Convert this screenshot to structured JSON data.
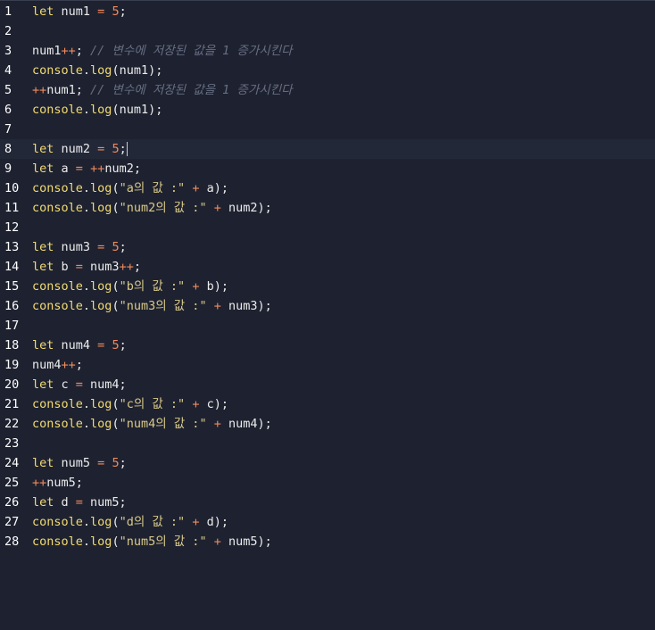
{
  "editor": {
    "active_line": 8,
    "lines": [
      {
        "number": "1",
        "tokens": [
          {
            "t": "let",
            "c": "kw"
          },
          {
            "t": " num1 ",
            "c": "id"
          },
          {
            "t": "=",
            "c": "op"
          },
          {
            "t": " ",
            "c": "id"
          },
          {
            "t": "5",
            "c": "num"
          },
          {
            "t": ";",
            "c": "punc"
          }
        ]
      },
      {
        "number": "2",
        "tokens": []
      },
      {
        "number": "3",
        "tokens": [
          {
            "t": "num1",
            "c": "id"
          },
          {
            "t": "++",
            "c": "op"
          },
          {
            "t": "; ",
            "c": "punc"
          },
          {
            "t": "// 변수에 저장된 값을 1 증가시킨다",
            "c": "cmt"
          }
        ]
      },
      {
        "number": "4",
        "tokens": [
          {
            "t": "console",
            "c": "fn"
          },
          {
            "t": ".",
            "c": "punc"
          },
          {
            "t": "log",
            "c": "fn"
          },
          {
            "t": "(num1);",
            "c": "punc"
          }
        ]
      },
      {
        "number": "5",
        "tokens": [
          {
            "t": "++",
            "c": "op"
          },
          {
            "t": "num1",
            "c": "id"
          },
          {
            "t": "; ",
            "c": "punc"
          },
          {
            "t": "// 변수에 저장된 값을 1 증가시킨다",
            "c": "cmt"
          }
        ]
      },
      {
        "number": "6",
        "tokens": [
          {
            "t": "console",
            "c": "fn"
          },
          {
            "t": ".",
            "c": "punc"
          },
          {
            "t": "log",
            "c": "fn"
          },
          {
            "t": "(num1);",
            "c": "punc"
          }
        ]
      },
      {
        "number": "7",
        "tokens": []
      },
      {
        "number": "8",
        "tokens": [
          {
            "t": "let",
            "c": "kw"
          },
          {
            "t": " num2 ",
            "c": "id"
          },
          {
            "t": "=",
            "c": "op"
          },
          {
            "t": " ",
            "c": "id"
          },
          {
            "t": "5",
            "c": "num"
          },
          {
            "t": ";",
            "c": "punc"
          }
        ],
        "cursor": true
      },
      {
        "number": "9",
        "tokens": [
          {
            "t": "let",
            "c": "kw"
          },
          {
            "t": " a ",
            "c": "id"
          },
          {
            "t": "=",
            "c": "op"
          },
          {
            "t": " ",
            "c": "id"
          },
          {
            "t": "++",
            "c": "op"
          },
          {
            "t": "num2;",
            "c": "id"
          }
        ]
      },
      {
        "number": "10",
        "tokens": [
          {
            "t": "console",
            "c": "fn"
          },
          {
            "t": ".",
            "c": "punc"
          },
          {
            "t": "log",
            "c": "fn"
          },
          {
            "t": "(",
            "c": "punc"
          },
          {
            "t": "\"a의 값 :\"",
            "c": "str"
          },
          {
            "t": " ",
            "c": "id"
          },
          {
            "t": "+",
            "c": "op"
          },
          {
            "t": " a);",
            "c": "punc"
          }
        ]
      },
      {
        "number": "11",
        "tokens": [
          {
            "t": "console",
            "c": "fn"
          },
          {
            "t": ".",
            "c": "punc"
          },
          {
            "t": "log",
            "c": "fn"
          },
          {
            "t": "(",
            "c": "punc"
          },
          {
            "t": "\"num2의 값 :\"",
            "c": "str"
          },
          {
            "t": " ",
            "c": "id"
          },
          {
            "t": "+",
            "c": "op"
          },
          {
            "t": " num2);",
            "c": "punc"
          }
        ]
      },
      {
        "number": "12",
        "tokens": []
      },
      {
        "number": "13",
        "tokens": [
          {
            "t": "let",
            "c": "kw"
          },
          {
            "t": " num3 ",
            "c": "id"
          },
          {
            "t": "=",
            "c": "op"
          },
          {
            "t": " ",
            "c": "id"
          },
          {
            "t": "5",
            "c": "num"
          },
          {
            "t": ";",
            "c": "punc"
          }
        ]
      },
      {
        "number": "14",
        "tokens": [
          {
            "t": "let",
            "c": "kw"
          },
          {
            "t": " b ",
            "c": "id"
          },
          {
            "t": "=",
            "c": "op"
          },
          {
            "t": " num3",
            "c": "id"
          },
          {
            "t": "++",
            "c": "op"
          },
          {
            "t": ";",
            "c": "punc"
          }
        ]
      },
      {
        "number": "15",
        "tokens": [
          {
            "t": "console",
            "c": "fn"
          },
          {
            "t": ".",
            "c": "punc"
          },
          {
            "t": "log",
            "c": "fn"
          },
          {
            "t": "(",
            "c": "punc"
          },
          {
            "t": "\"b의 값 :\"",
            "c": "str"
          },
          {
            "t": " ",
            "c": "id"
          },
          {
            "t": "+",
            "c": "op"
          },
          {
            "t": " b);",
            "c": "punc"
          }
        ]
      },
      {
        "number": "16",
        "tokens": [
          {
            "t": "console",
            "c": "fn"
          },
          {
            "t": ".",
            "c": "punc"
          },
          {
            "t": "log",
            "c": "fn"
          },
          {
            "t": "(",
            "c": "punc"
          },
          {
            "t": "\"num3의 값 :\"",
            "c": "str"
          },
          {
            "t": " ",
            "c": "id"
          },
          {
            "t": "+",
            "c": "op"
          },
          {
            "t": " num3);",
            "c": "punc"
          }
        ]
      },
      {
        "number": "17",
        "tokens": []
      },
      {
        "number": "18",
        "tokens": [
          {
            "t": "let",
            "c": "kw"
          },
          {
            "t": " num4 ",
            "c": "id"
          },
          {
            "t": "=",
            "c": "op"
          },
          {
            "t": " ",
            "c": "id"
          },
          {
            "t": "5",
            "c": "num"
          },
          {
            "t": ";",
            "c": "punc"
          }
        ]
      },
      {
        "number": "19",
        "tokens": [
          {
            "t": "num4",
            "c": "id"
          },
          {
            "t": "++",
            "c": "op"
          },
          {
            "t": ";",
            "c": "punc"
          }
        ]
      },
      {
        "number": "20",
        "tokens": [
          {
            "t": "let",
            "c": "kw"
          },
          {
            "t": " c ",
            "c": "id"
          },
          {
            "t": "=",
            "c": "op"
          },
          {
            "t": " num4;",
            "c": "id"
          }
        ]
      },
      {
        "number": "21",
        "tokens": [
          {
            "t": "console",
            "c": "fn"
          },
          {
            "t": ".",
            "c": "punc"
          },
          {
            "t": "log",
            "c": "fn"
          },
          {
            "t": "(",
            "c": "punc"
          },
          {
            "t": "\"c의 값 :\"",
            "c": "str"
          },
          {
            "t": " ",
            "c": "id"
          },
          {
            "t": "+",
            "c": "op"
          },
          {
            "t": " c);",
            "c": "punc"
          }
        ]
      },
      {
        "number": "22",
        "tokens": [
          {
            "t": "console",
            "c": "fn"
          },
          {
            "t": ".",
            "c": "punc"
          },
          {
            "t": "log",
            "c": "fn"
          },
          {
            "t": "(",
            "c": "punc"
          },
          {
            "t": "\"num4의 값 :\"",
            "c": "str"
          },
          {
            "t": " ",
            "c": "id"
          },
          {
            "t": "+",
            "c": "op"
          },
          {
            "t": " num4);",
            "c": "punc"
          }
        ]
      },
      {
        "number": "23",
        "tokens": []
      },
      {
        "number": "24",
        "tokens": [
          {
            "t": "let",
            "c": "kw"
          },
          {
            "t": " num5 ",
            "c": "id"
          },
          {
            "t": "=",
            "c": "op"
          },
          {
            "t": " ",
            "c": "id"
          },
          {
            "t": "5",
            "c": "num"
          },
          {
            "t": ";",
            "c": "punc"
          }
        ]
      },
      {
        "number": "25",
        "tokens": [
          {
            "t": "++",
            "c": "op"
          },
          {
            "t": "num5;",
            "c": "id"
          }
        ]
      },
      {
        "number": "26",
        "tokens": [
          {
            "t": "let",
            "c": "kw"
          },
          {
            "t": " d ",
            "c": "id"
          },
          {
            "t": "=",
            "c": "op"
          },
          {
            "t": " num5;",
            "c": "id"
          }
        ]
      },
      {
        "number": "27",
        "tokens": [
          {
            "t": "console",
            "c": "fn"
          },
          {
            "t": ".",
            "c": "punc"
          },
          {
            "t": "log",
            "c": "fn"
          },
          {
            "t": "(",
            "c": "punc"
          },
          {
            "t": "\"d의 값 :\"",
            "c": "str"
          },
          {
            "t": " ",
            "c": "id"
          },
          {
            "t": "+",
            "c": "op"
          },
          {
            "t": " d);",
            "c": "punc"
          }
        ]
      },
      {
        "number": "28",
        "tokens": [
          {
            "t": "console",
            "c": "fn"
          },
          {
            "t": ".",
            "c": "punc"
          },
          {
            "t": "log",
            "c": "fn"
          },
          {
            "t": "(",
            "c": "punc"
          },
          {
            "t": "\"num5의 값 :\"",
            "c": "str"
          },
          {
            "t": " ",
            "c": "id"
          },
          {
            "t": "+",
            "c": "op"
          },
          {
            "t": " num5);",
            "c": "punc"
          }
        ]
      }
    ]
  }
}
